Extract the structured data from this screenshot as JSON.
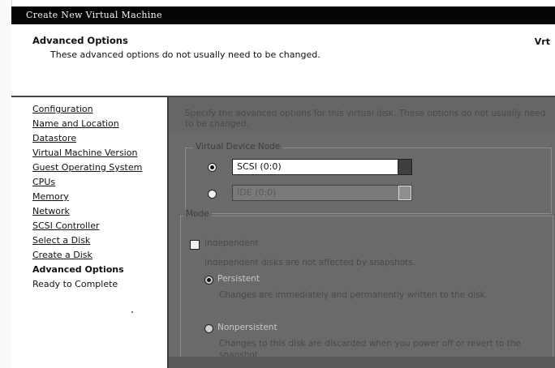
{
  "window": {
    "title": "Create New Virtual Machine"
  },
  "header": {
    "title": "Advanced Options",
    "subtitle": "These advanced options do not usually need to be changed.",
    "right_text": "Vrt"
  },
  "nav": {
    "items": [
      {
        "label": "Configuration",
        "state": "link"
      },
      {
        "label": "Name and Location",
        "state": "link"
      },
      {
        "label": "Datastore",
        "state": "link"
      },
      {
        "label": "Virtual Machine Version",
        "state": "link"
      },
      {
        "label": "Guest Operating System",
        "state": "link"
      },
      {
        "label": "CPUs",
        "state": "link"
      },
      {
        "label": "Memory",
        "state": "link"
      },
      {
        "label": "Network",
        "state": "link"
      },
      {
        "label": "SCSI Controller",
        "state": "link"
      },
      {
        "label": "Select a Disk",
        "state": "link"
      },
      {
        "label": "Create a Disk",
        "state": "link"
      },
      {
        "label": "Advanced Options",
        "state": "current"
      },
      {
        "label": "Ready to Complete",
        "state": "plain"
      }
    ]
  },
  "content": {
    "description": "Specify the advanced options for this virtual disk. These options do not usually need to be changed.",
    "vdn": {
      "legend": "Virtual Device Node",
      "scsi_value": "SCSI (0:0)",
      "ide_value": "IDE (0:0)"
    },
    "mode": {
      "legend": "Mode",
      "independent_label": "Independent",
      "independent_desc": "Independent disks are not affected by snapshots.",
      "persistent_label": "Persistent",
      "persistent_desc": "Changes are immediately and permanently written to the disk.",
      "nonpersistent_label": "Nonpersistent",
      "nonpersistent_desc_1": "Changes to this disk are discarded when you power off or revert to the",
      "nonpersistent_desc_2": "snapshot."
    }
  },
  "colors": {
    "titlebar": "#050505",
    "content_bg": "#6a6a6a",
    "nav_bg": "#ffffff"
  }
}
